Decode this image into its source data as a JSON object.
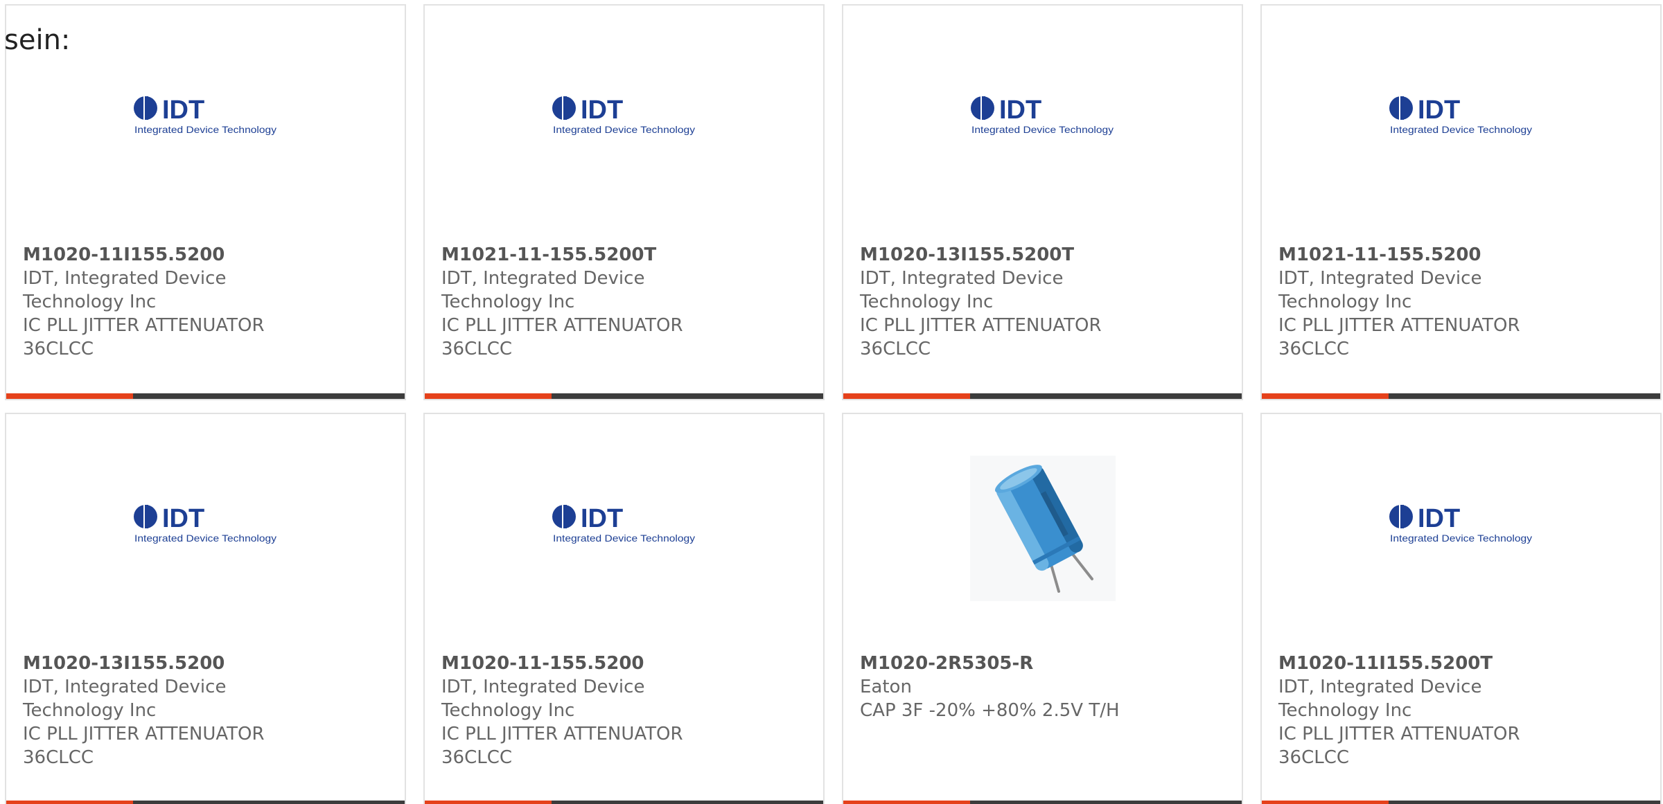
{
  "intro_text": "sein:",
  "colors": {
    "accent": "#e5411b",
    "bar_dark": "#3c3c3c",
    "idt_blue": "#1d3f94",
    "text_gray": "#666666"
  },
  "products": [
    {
      "image": "idt-logo",
      "logo_mark": "IDT",
      "logo_tagline": "Integrated Device Technology",
      "part_number": "M1020-11I155.5200",
      "manufacturer": "IDT, Integrated Device\nTechnology Inc",
      "description": "IC PLL JITTER ATTENUATOR\n36CLCC"
    },
    {
      "image": "idt-logo",
      "logo_mark": "IDT",
      "logo_tagline": "Integrated Device Technology",
      "part_number": "M1021-11-155.5200T",
      "manufacturer": "IDT, Integrated Device\nTechnology Inc",
      "description": "IC PLL JITTER ATTENUATOR\n36CLCC"
    },
    {
      "image": "idt-logo",
      "logo_mark": "IDT",
      "logo_tagline": "Integrated Device Technology",
      "part_number": "M1020-13I155.5200T",
      "manufacturer": "IDT, Integrated Device\nTechnology Inc",
      "description": "IC PLL JITTER ATTENUATOR\n36CLCC"
    },
    {
      "image": "idt-logo",
      "logo_mark": "IDT",
      "logo_tagline": "Integrated Device Technology",
      "part_number": "M1021-11-155.5200",
      "manufacturer": "IDT, Integrated Device\nTechnology Inc",
      "description": "IC PLL JITTER ATTENUATOR\n36CLCC"
    },
    {
      "image": "idt-logo",
      "logo_mark": "IDT",
      "logo_tagline": "Integrated Device Technology",
      "part_number": "M1020-13I155.5200",
      "manufacturer": "IDT, Integrated Device\nTechnology Inc",
      "description": "IC PLL JITTER ATTENUATOR\n36CLCC"
    },
    {
      "image": "idt-logo",
      "logo_mark": "IDT",
      "logo_tagline": "Integrated Device Technology",
      "part_number": "M1020-11-155.5200",
      "manufacturer": "IDT, Integrated Device\nTechnology Inc",
      "description": "IC PLL JITTER ATTENUATOR\n36CLCC"
    },
    {
      "image": "capacitor-photo",
      "part_number": "M1020-2R5305-R",
      "manufacturer": "Eaton",
      "description": "CAP 3F -20% +80% 2.5V T/H"
    },
    {
      "image": "idt-logo",
      "logo_mark": "IDT",
      "logo_tagline": "Integrated Device Technology",
      "part_number": "M1020-11I155.5200T",
      "manufacturer": "IDT, Integrated Device\nTechnology Inc",
      "description": "IC PLL JITTER ATTENUATOR\n36CLCC"
    }
  ]
}
